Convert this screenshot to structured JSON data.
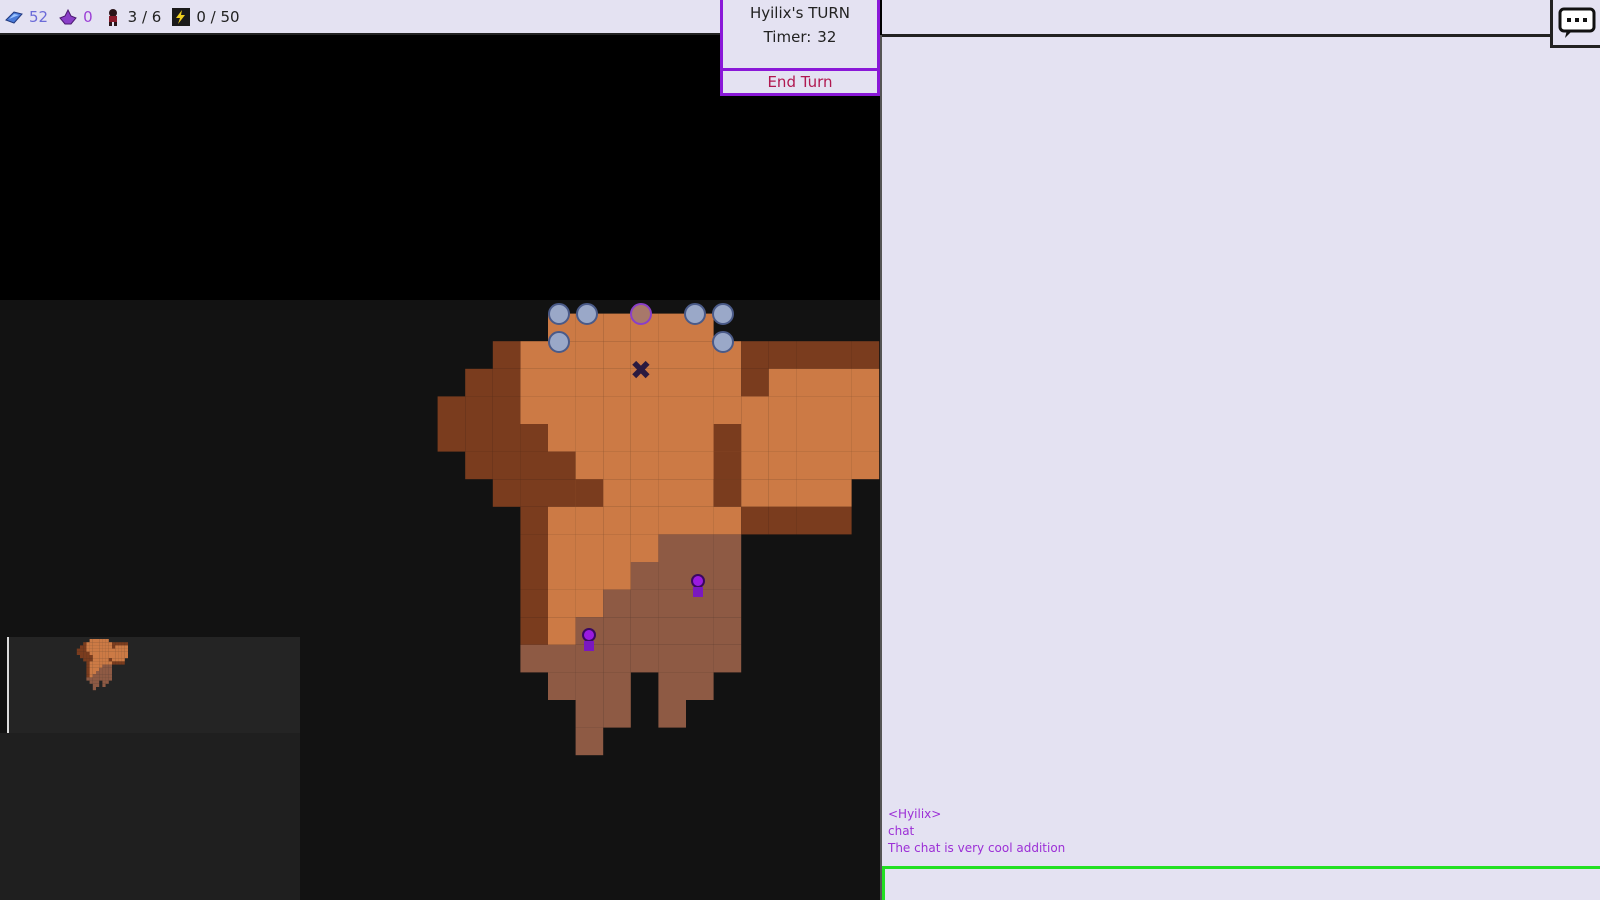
{
  "resources": {
    "crystals": {
      "icon": "blue-crystal-icon",
      "value": "52"
    },
    "gems": {
      "icon": "purple-gem-icon",
      "value": "0"
    },
    "units": {
      "icon": "unit-figure-icon",
      "value": "3 / 6"
    },
    "energy": {
      "icon": "lightning-icon",
      "value": "0 / 50"
    }
  },
  "turn": {
    "player_turn": "Hyilix's TURN",
    "timer_label": "Timer:",
    "timer_value": "32",
    "end_turn_label": "End Turn"
  },
  "chat": {
    "button_icon": "chat-bubble-icon",
    "messages": [
      {
        "text": "<Hyilix>"
      },
      {
        "text": "chat"
      },
      {
        "text": "The chat is very cool addition"
      }
    ],
    "input_value": ""
  },
  "colors": {
    "panel_bg": "#e4e2f2",
    "accent_purple": "#8a18d8",
    "end_turn_text": "#b01850",
    "chat_text": "#9c2fd6",
    "chat_input_border": "#22e022",
    "dirt_light": "#cc7a45",
    "dirt_dark": "#7a3c1e",
    "dirt_rough": "#8e5a44"
  }
}
